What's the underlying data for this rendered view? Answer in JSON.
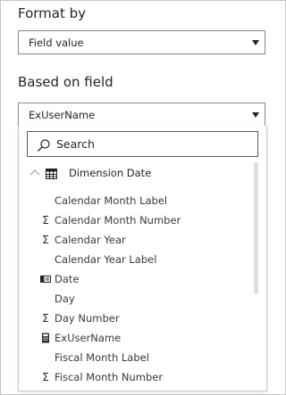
{
  "format_by": {
    "label": "Format by",
    "selected": "Field value"
  },
  "based_on_field": {
    "label": "Based on field",
    "selected": "ExUserName"
  },
  "field_picker": {
    "search_placeholder": "Search",
    "group": {
      "name": "Dimension Date",
      "expanded": true,
      "icon": "table-icon"
    },
    "fields": [
      {
        "label": "Calendar Month Label",
        "icon": "none"
      },
      {
        "label": "Calendar Month Number",
        "icon": "sigma-icon"
      },
      {
        "label": "Calendar Year",
        "icon": "sigma-icon"
      },
      {
        "label": "Calendar Year Label",
        "icon": "none"
      },
      {
        "label": "Date",
        "icon": "hierarchy-icon"
      },
      {
        "label": "Day",
        "icon": "none"
      },
      {
        "label": "Day Number",
        "icon": "sigma-icon"
      },
      {
        "label": "ExUserName",
        "icon": "calculator-icon"
      },
      {
        "label": "Fiscal Month Label",
        "icon": "none"
      },
      {
        "label": "Fiscal Month Number",
        "icon": "sigma-icon"
      }
    ]
  },
  "colors": {
    "border": "#8a8886",
    "text": "#252423",
    "scrollbar": "#e1dfdd"
  }
}
